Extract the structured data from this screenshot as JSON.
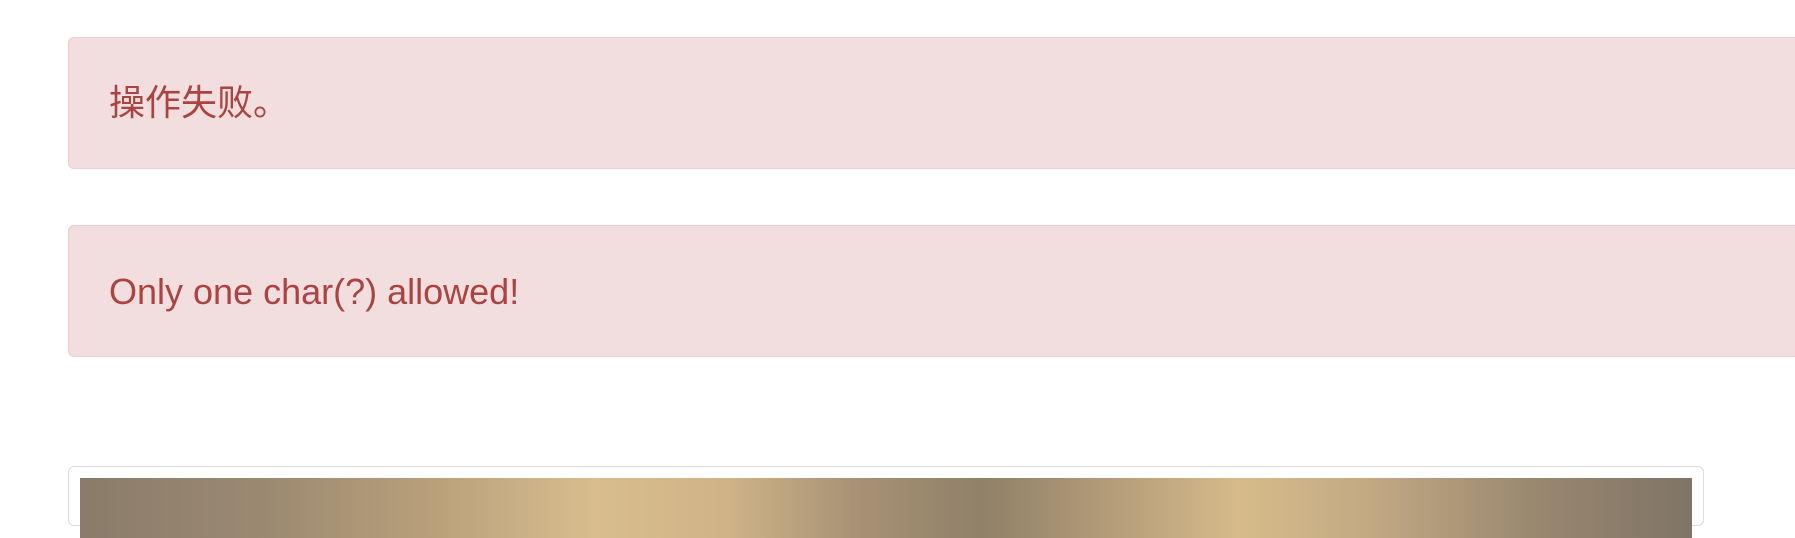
{
  "alerts": [
    {
      "message": "操作失败。"
    },
    {
      "message": "Only one char(?) allowed!"
    }
  ],
  "colors": {
    "alert_background": "#f2dede",
    "alert_border": "#ebccd1",
    "alert_text": "#a94442"
  }
}
